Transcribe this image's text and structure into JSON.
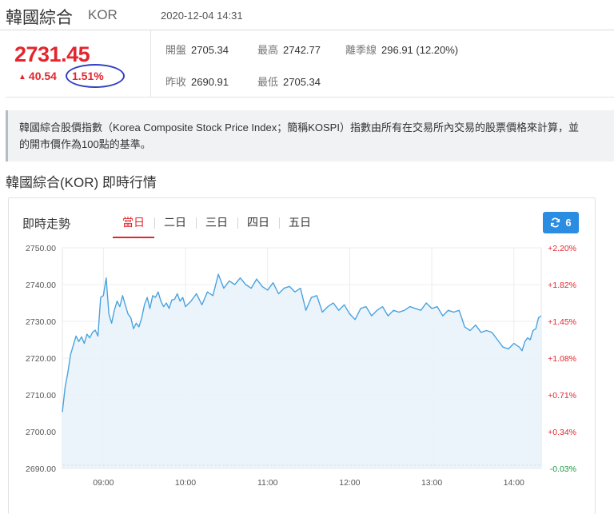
{
  "header": {
    "title": "韓國綜合",
    "symbol": "KOR",
    "datetime": "2020-12-04 14:31"
  },
  "quote": {
    "price": "2731.45",
    "change": "40.54",
    "change_pct": "1.51%",
    "stats": [
      {
        "label": "開盤",
        "value": "2705.34"
      },
      {
        "label": "最高",
        "value": "2742.77"
      },
      {
        "label": "離季線",
        "value": "296.91 (12.20%)"
      },
      {
        "label": "昨收",
        "value": "2690.91"
      },
      {
        "label": "最低",
        "value": "2705.34"
      }
    ]
  },
  "description": {
    "line1": "韓國綜合股價指數（Korea Composite Stock Price Index；簡稱KOSPI）指數由所有在交易所內交易的股票價格來計算，並",
    "line2": "的開市價作為100點的基準。"
  },
  "section_title": "韓國綜合(KOR) 即時行情",
  "chart_panel": {
    "label": "即時走勢",
    "tabs": [
      "當日",
      "二日",
      "三日",
      "四日",
      "五日"
    ],
    "active_tab": 0,
    "refresh_label": "6"
  },
  "colors": {
    "up": "#e4252c",
    "down": "#1a9a3c",
    "line": "#4aa3df",
    "area": "#eaf3fb",
    "accent": "#2b8de2",
    "annotation": "#2f3fc0"
  },
  "chart_data": {
    "type": "area",
    "title": "",
    "xlabel": "",
    "ylabel": "",
    "reference_close": 2690.91,
    "ylim": [
      2690,
      2750
    ],
    "yticks": [
      2690,
      2700,
      2710,
      2720,
      2730,
      2740,
      2750
    ],
    "ytick_labels": [
      "2690.00",
      "2700.00",
      "2710.00",
      "2720.00",
      "2730.00",
      "2740.00",
      "2750.00"
    ],
    "right_tick_labels": [
      "-0.03%",
      "+0.34%",
      "+0.71%",
      "+1.08%",
      "+1.45%",
      "+1.82%",
      "+2.20%"
    ],
    "xticks": [
      "09:00",
      "10:00",
      "11:00",
      "12:00",
      "13:00",
      "14:00"
    ],
    "x_range": [
      "08:30",
      "14:20"
    ],
    "grid": true,
    "series": [
      {
        "x": [
          "08:30",
          "08:32",
          "08:34",
          "08:36",
          "08:38",
          "08:40",
          "08:42",
          "08:44",
          "08:46",
          "08:48",
          "08:50",
          "08:52",
          "08:54",
          "08:56",
          "08:58",
          "09:00",
          "09:02",
          "09:04",
          "09:06",
          "09:08",
          "09:10",
          "09:12",
          "09:14",
          "09:16",
          "09:18",
          "09:20",
          "09:22",
          "09:24",
          "09:26",
          "09:28",
          "09:30",
          "09:32",
          "09:34",
          "09:36",
          "09:38",
          "09:40",
          "09:42",
          "09:44",
          "09:46",
          "09:48",
          "09:50",
          "09:52",
          "09:54",
          "09:56",
          "09:58",
          "10:00",
          "10:04",
          "10:08",
          "10:12",
          "10:16",
          "10:20",
          "10:24",
          "10:28",
          "10:32",
          "10:36",
          "10:40",
          "10:44",
          "10:48",
          "10:52",
          "10:56",
          "11:00",
          "11:04",
          "11:08",
          "11:12",
          "11:16",
          "11:20",
          "11:24",
          "11:28",
          "11:32",
          "11:36",
          "11:40",
          "11:44",
          "11:48",
          "11:52",
          "11:56",
          "12:00",
          "12:04",
          "12:08",
          "12:12",
          "12:16",
          "12:20",
          "12:24",
          "12:28",
          "12:32",
          "12:36",
          "12:40",
          "12:44",
          "12:48",
          "12:52",
          "12:56",
          "13:00",
          "13:04",
          "13:08",
          "13:12",
          "13:16",
          "13:20",
          "13:24",
          "13:28",
          "13:32",
          "13:36",
          "13:40",
          "13:44",
          "13:48",
          "13:52",
          "13:56",
          "14:00",
          "14:02",
          "14:04",
          "14:06",
          "14:08",
          "14:10",
          "14:12",
          "14:14",
          "14:16",
          "14:18",
          "14:20"
        ],
        "values": [
          2705.3,
          2712.0,
          2716.0,
          2721.0,
          2723.5,
          2726.0,
          2724.5,
          2725.8,
          2724.0,
          2726.5,
          2725.5,
          2727.0,
          2727.6,
          2726.0,
          2736.5,
          2737.0,
          2741.8,
          2732.0,
          2729.5,
          2733.0,
          2735.5,
          2734.0,
          2737.0,
          2734.5,
          2732.0,
          2731.0,
          2728.0,
          2729.5,
          2728.5,
          2731.0,
          2734.5,
          2736.5,
          2733.5,
          2737.0,
          2736.5,
          2738.0,
          2735.5,
          2734.0,
          2735.0,
          2733.5,
          2735.8,
          2736.0,
          2737.5,
          2735.5,
          2736.5,
          2734.0,
          2735.5,
          2737.5,
          2734.5,
          2738.0,
          2737.0,
          2742.8,
          2739.0,
          2741.0,
          2740.0,
          2741.8,
          2740.0,
          2739.0,
          2741.5,
          2739.5,
          2738.5,
          2740.5,
          2737.5,
          2739.0,
          2739.5,
          2738.0,
          2739.0,
          2733.0,
          2736.5,
          2737.0,
          2732.5,
          2734.0,
          2735.0,
          2733.0,
          2734.5,
          2732.0,
          2730.5,
          2733.5,
          2734.0,
          2731.5,
          2733.0,
          2734.0,
          2731.5,
          2733.0,
          2732.5,
          2733.0,
          2734.0,
          2733.5,
          2733.0,
          2735.0,
          2733.5,
          2734.0,
          2731.5,
          2733.0,
          2732.5,
          2733.0,
          2728.5,
          2727.5,
          2729.0,
          2727.0,
          2727.5,
          2727.0,
          2725.0,
          2723.0,
          2722.5,
          2724.0,
          2723.5,
          2723.0,
          2722.0,
          2724.5,
          2725.5,
          2725.0,
          2727.5,
          2728.0,
          2731.0,
          2731.45
        ]
      }
    ]
  }
}
